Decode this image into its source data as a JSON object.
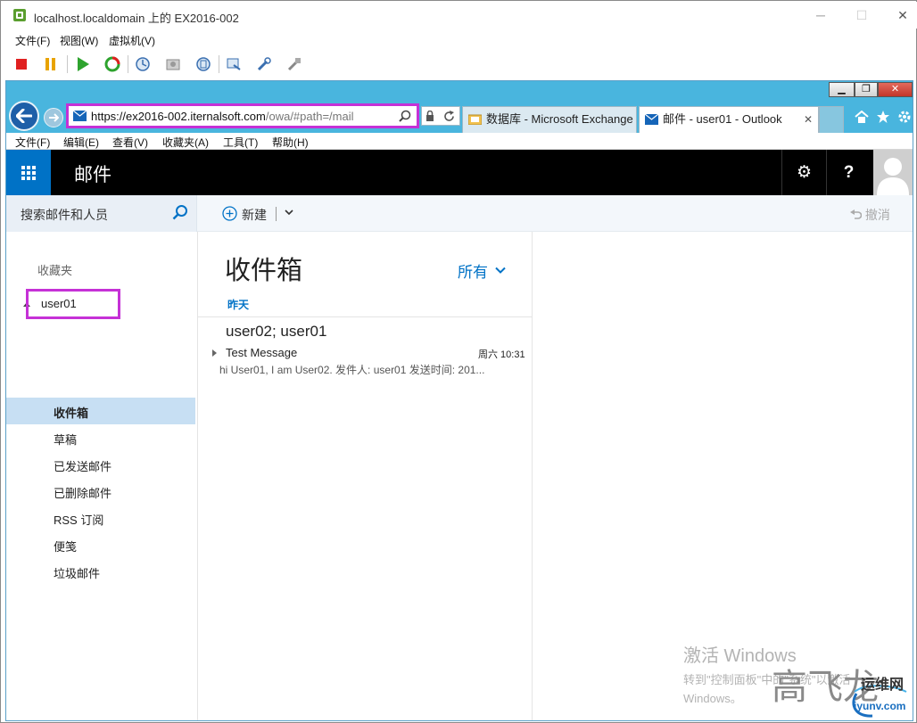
{
  "vm": {
    "title": "localhost.localdomain 上的 EX2016-002",
    "menu": [
      "文件(F)",
      "视图(W)",
      "虚拟机(V)"
    ],
    "toolbar": [
      "stop-icon",
      "pause-icon",
      "play-icon",
      "reset-icon",
      "snapshot-icon",
      "revert-snapshot-icon",
      "snapshot-manager-icon",
      "console-send-icon",
      "settings-icon",
      "connect-device-icon"
    ],
    "window_controls": [
      "─",
      "☐",
      "✕"
    ]
  },
  "ie": {
    "window_controls": [
      "▁",
      "❐",
      "✕"
    ],
    "address": {
      "url_prefix": "https://ex2016-002.",
      "url_domain": "iternalsoft.com",
      "url_path": "/owa/#path=/mail"
    },
    "tabs": [
      {
        "label": "数据库 - Microsoft Exchange",
        "icon": "exchange-tab-icon"
      },
      {
        "label": "邮件 - user01 - Outlook",
        "icon": "mail-tab-icon",
        "close": "✕"
      }
    ],
    "menu": [
      "文件(F)",
      "编辑(E)",
      "查看(V)",
      "收藏夹(A)",
      "工具(T)",
      "帮助(H)"
    ]
  },
  "owa": {
    "app_title": "邮件",
    "settings_glyph": "⚙",
    "help_glyph": "?",
    "search_placeholder": "搜索邮件和人员",
    "new_label": "新建",
    "undo_label": "撤消",
    "folders": {
      "favorites_label": "收藏夹",
      "account": "user01",
      "items": [
        "收件箱",
        "草稿",
        "已发送邮件",
        "已删除邮件",
        "RSS 订阅",
        "便笺",
        "垃圾邮件"
      ],
      "selected_index": 0
    },
    "list": {
      "title": "收件箱",
      "filter": "所有",
      "group": "昨天",
      "messages": [
        {
          "from": "user02; user01",
          "subject": "Test Message",
          "time": "周六 10:31",
          "preview": "hi User01, I am User02. 发件人: user01 发送时间: 201..."
        }
      ]
    }
  },
  "watermark": {
    "title": "激活 Windows",
    "line1": "转到\"控制面板\"中的\"系统\"以激活",
    "line2": "Windows。",
    "sign": "高飞龙",
    "logo_text": "运维网",
    "logo_url": "iyunv.com"
  }
}
